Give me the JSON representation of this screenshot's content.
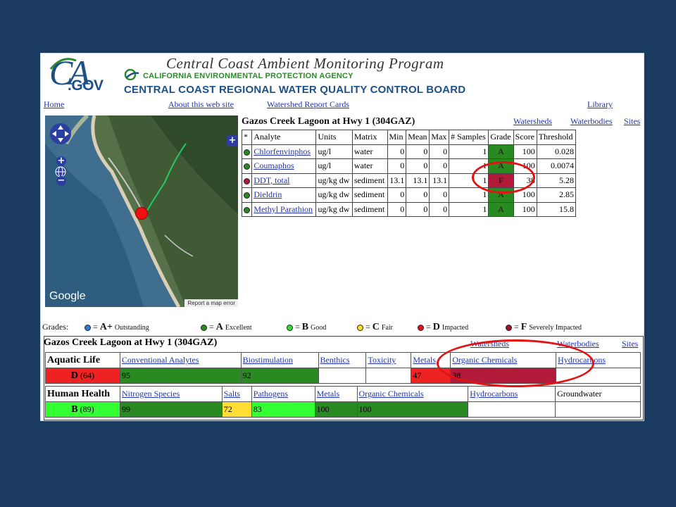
{
  "header": {
    "logo_ca": "CA",
    "logo_gov": ".GOV",
    "program_title": "Central Coast Ambient Monitoring Program",
    "agency": "CALIFORNIA ENVIRONMENTAL PROTECTION AGENCY",
    "board": "CENTRAL COAST REGIONAL WATER QUALITY CONTROL BOARD"
  },
  "nav": {
    "home": "Home",
    "about": "About this web site",
    "report_cards": "Watershed Report Cards",
    "library": "Library"
  },
  "map": {
    "google_label": "Google",
    "report_error": "Report a map error"
  },
  "station": {
    "title": "Gazos Creek Lagoon at Hwy 1 (304GAZ)",
    "links": [
      "Watersheds",
      "Waterbodies",
      "Sites"
    ]
  },
  "detail_table": {
    "headers": [
      "*",
      "Analyte",
      "Units",
      "Matrix",
      "Min",
      "Mean",
      "Max",
      "# Samples",
      "Grade",
      "Score",
      "Threshold"
    ],
    "rows": [
      {
        "dot": "#2a8a22",
        "analyte": "Chlorfenvinphos",
        "units": "ug/l",
        "matrix": "water",
        "min": "0",
        "mean": "0",
        "max": "0",
        "samples": "1",
        "grade": "A",
        "score": "100",
        "threshold": "0.028"
      },
      {
        "dot": "#2a8a22",
        "analyte": "Coumaphos",
        "units": "ug/l",
        "matrix": "water",
        "min": "0",
        "mean": "0",
        "max": "0",
        "samples": "1",
        "grade": "A",
        "score": "100",
        "threshold": "0.0074"
      },
      {
        "dot": "#b31a3a",
        "analyte": "DDT, total",
        "units": "ug/kg dw",
        "matrix": "sediment",
        "min": "13.1",
        "mean": "13.1",
        "max": "13.1",
        "samples": "1",
        "grade": "F",
        "score": "38",
        "threshold": "5.28"
      },
      {
        "dot": "#2a8a22",
        "analyte": "Dieldrin",
        "units": "ug/kg dw",
        "matrix": "sediment",
        "min": "0",
        "mean": "0",
        "max": "0",
        "samples": "1",
        "grade": "A",
        "score": "100",
        "threshold": "2.85"
      },
      {
        "dot": "#2a8a22",
        "analyte": "Methyl Parathion",
        "units": "ug/kg dw",
        "matrix": "sediment",
        "min": "0",
        "mean": "0",
        "max": "0",
        "samples": "1",
        "grade": "A",
        "score": "100",
        "threshold": "15.8"
      }
    ]
  },
  "legend": {
    "label": "Grades:",
    "items": [
      {
        "color": "#2a7fd4",
        "grade": "A+",
        "desc": "Outstanding"
      },
      {
        "color": "#2a8a22",
        "grade": "A",
        "desc": "Excellent"
      },
      {
        "color": "#33dd33",
        "grade": "B",
        "desc": "Good"
      },
      {
        "color": "#ffdd22",
        "grade": "C",
        "desc": "Fair"
      },
      {
        "color": "#dd1122",
        "grade": "D",
        "desc": "Impacted"
      },
      {
        "color": "#a0122a",
        "grade": "F",
        "desc": "Severely Impacted"
      }
    ]
  },
  "summary": {
    "title": "Gazos Creek Lagoon at Hwy 1 (304GAZ)",
    "links": [
      "Watersheds",
      "Waterbodies",
      "Sites"
    ],
    "aquatic": {
      "label": "Aquatic Life",
      "grade": "D",
      "score": "(64)",
      "categories": [
        "Conventional Analytes",
        "Biostimulation",
        "Benthics",
        "Toxicity",
        "Metals",
        "Organic Chemicals",
        "Hydrocarbons"
      ],
      "values": [
        "95",
        "92",
        "",
        "",
        "47",
        "38",
        ""
      ]
    },
    "human": {
      "label": "Human Health",
      "grade": "B",
      "score": "(89)",
      "categories": [
        "Nitrogen Species",
        "Salts",
        "Pathogens",
        "Metals",
        "Organic Chemicals",
        "Hydrocarbons",
        "Groundwater"
      ],
      "values": [
        "99",
        "72",
        "83",
        "100",
        "100",
        "",
        ""
      ]
    }
  }
}
